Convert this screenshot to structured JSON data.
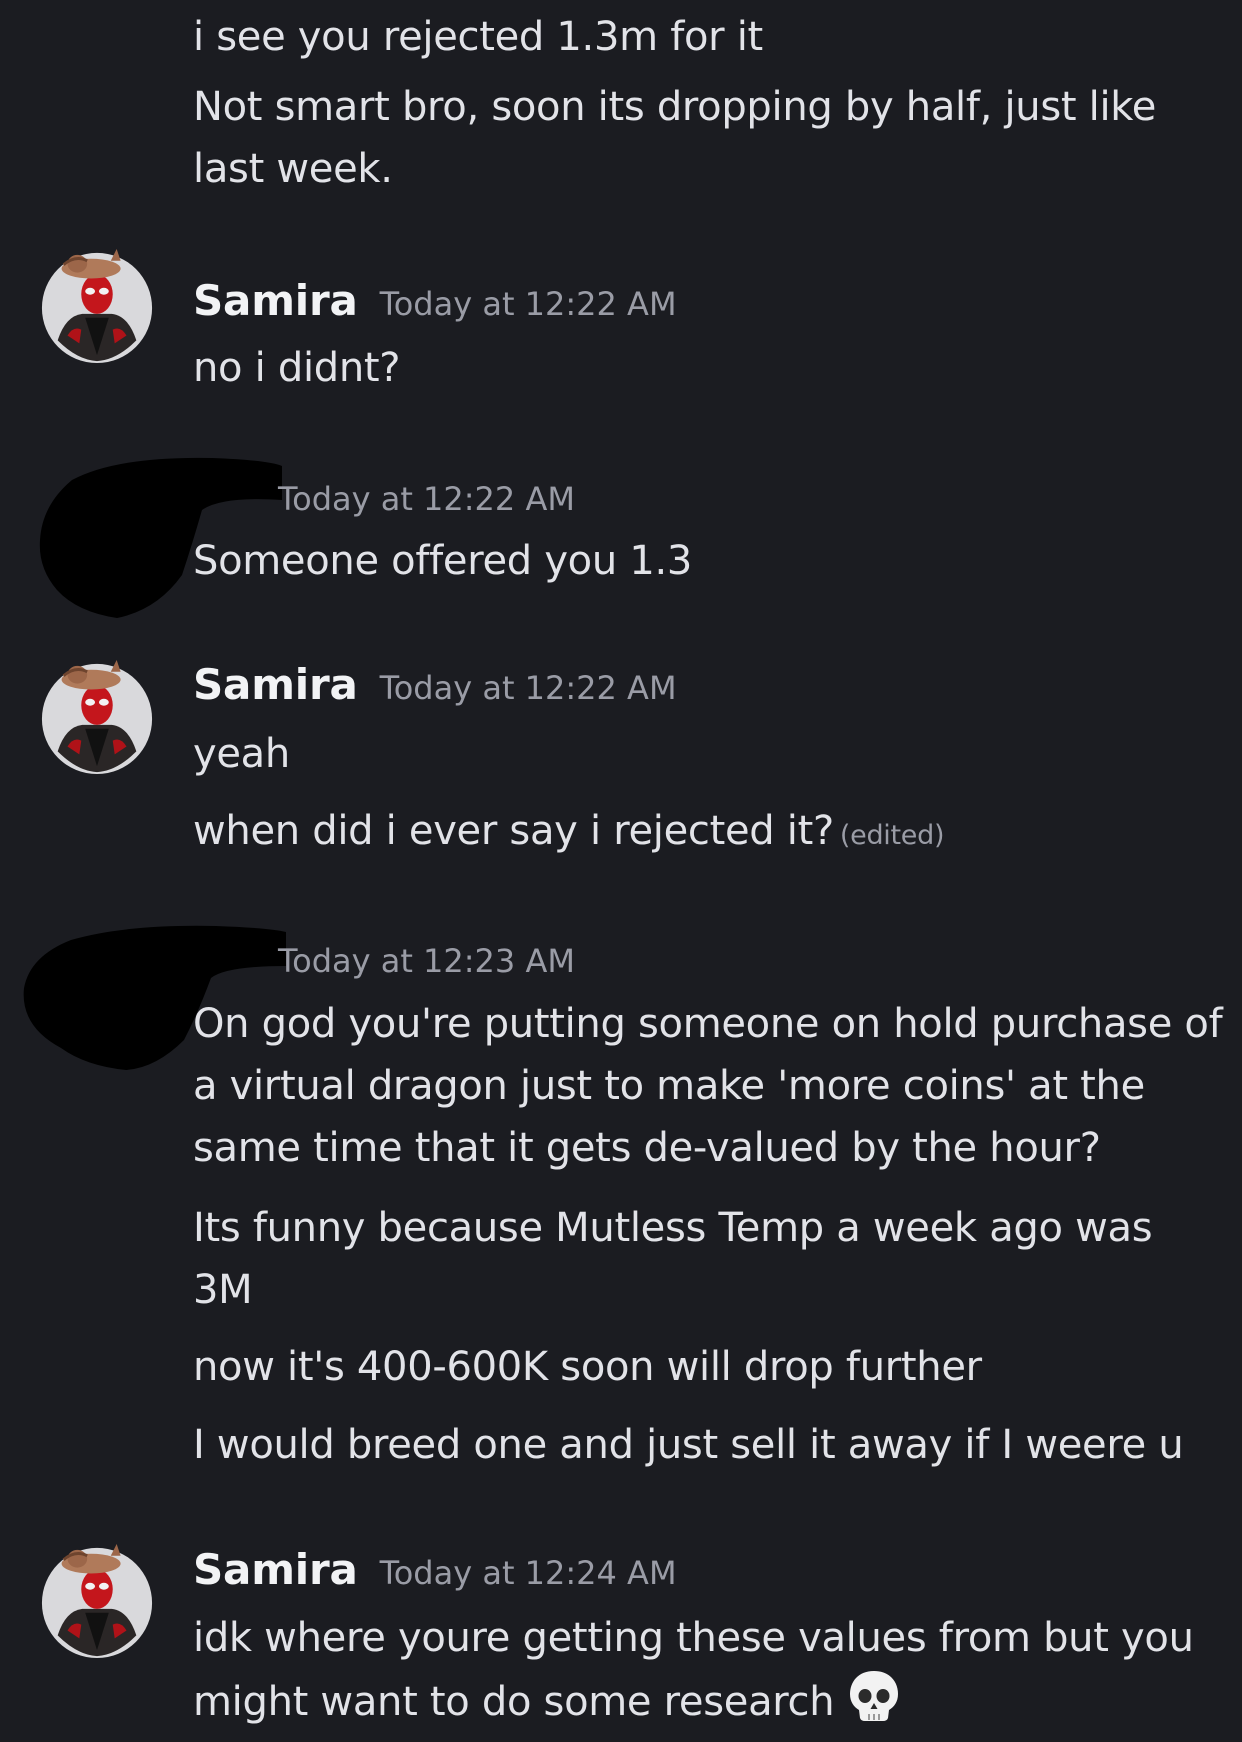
{
  "messages": {
    "m1": {
      "lines": [
        "i see you rejected 1.3m for it",
        "Not smart bro, soon its dropping by half, just like last week."
      ]
    },
    "m2": {
      "username": "Samira",
      "timestamp": "Today at 12:22 AM",
      "lines": [
        "no i didnt?"
      ]
    },
    "m3": {
      "timestamp": "Today at 12:22 AM",
      "lines": [
        "Someone offered you 1.3"
      ]
    },
    "m4": {
      "username": "Samira",
      "timestamp": "Today at 12:22 AM",
      "lines": [
        "yeah",
        "when did i ever say i rejected it?"
      ],
      "edited": "(edited)"
    },
    "m5": {
      "timestamp": "Today at 12:23 AM",
      "lines": [
        "On god you're putting someone on hold purchase of a virtual dragon just to make 'more coins' at the same time that it gets de-valued by the hour?",
        "Its funny because Mutless Temp a week ago was 3M",
        "now it's 400-600K soon will drop further",
        "I would breed one and just sell it away if I weere u"
      ]
    },
    "m6": {
      "username": "Samira",
      "timestamp": "Today at 12:24 AM",
      "lines": [
        "idk where youre getting these values from but you might want to do some research"
      ],
      "emoji": "skull-emoji"
    }
  },
  "colors": {
    "background": "#1b1c21",
    "text": "#e2e3e8",
    "muted": "#9a9ca6",
    "username": "#f2f3f5"
  }
}
